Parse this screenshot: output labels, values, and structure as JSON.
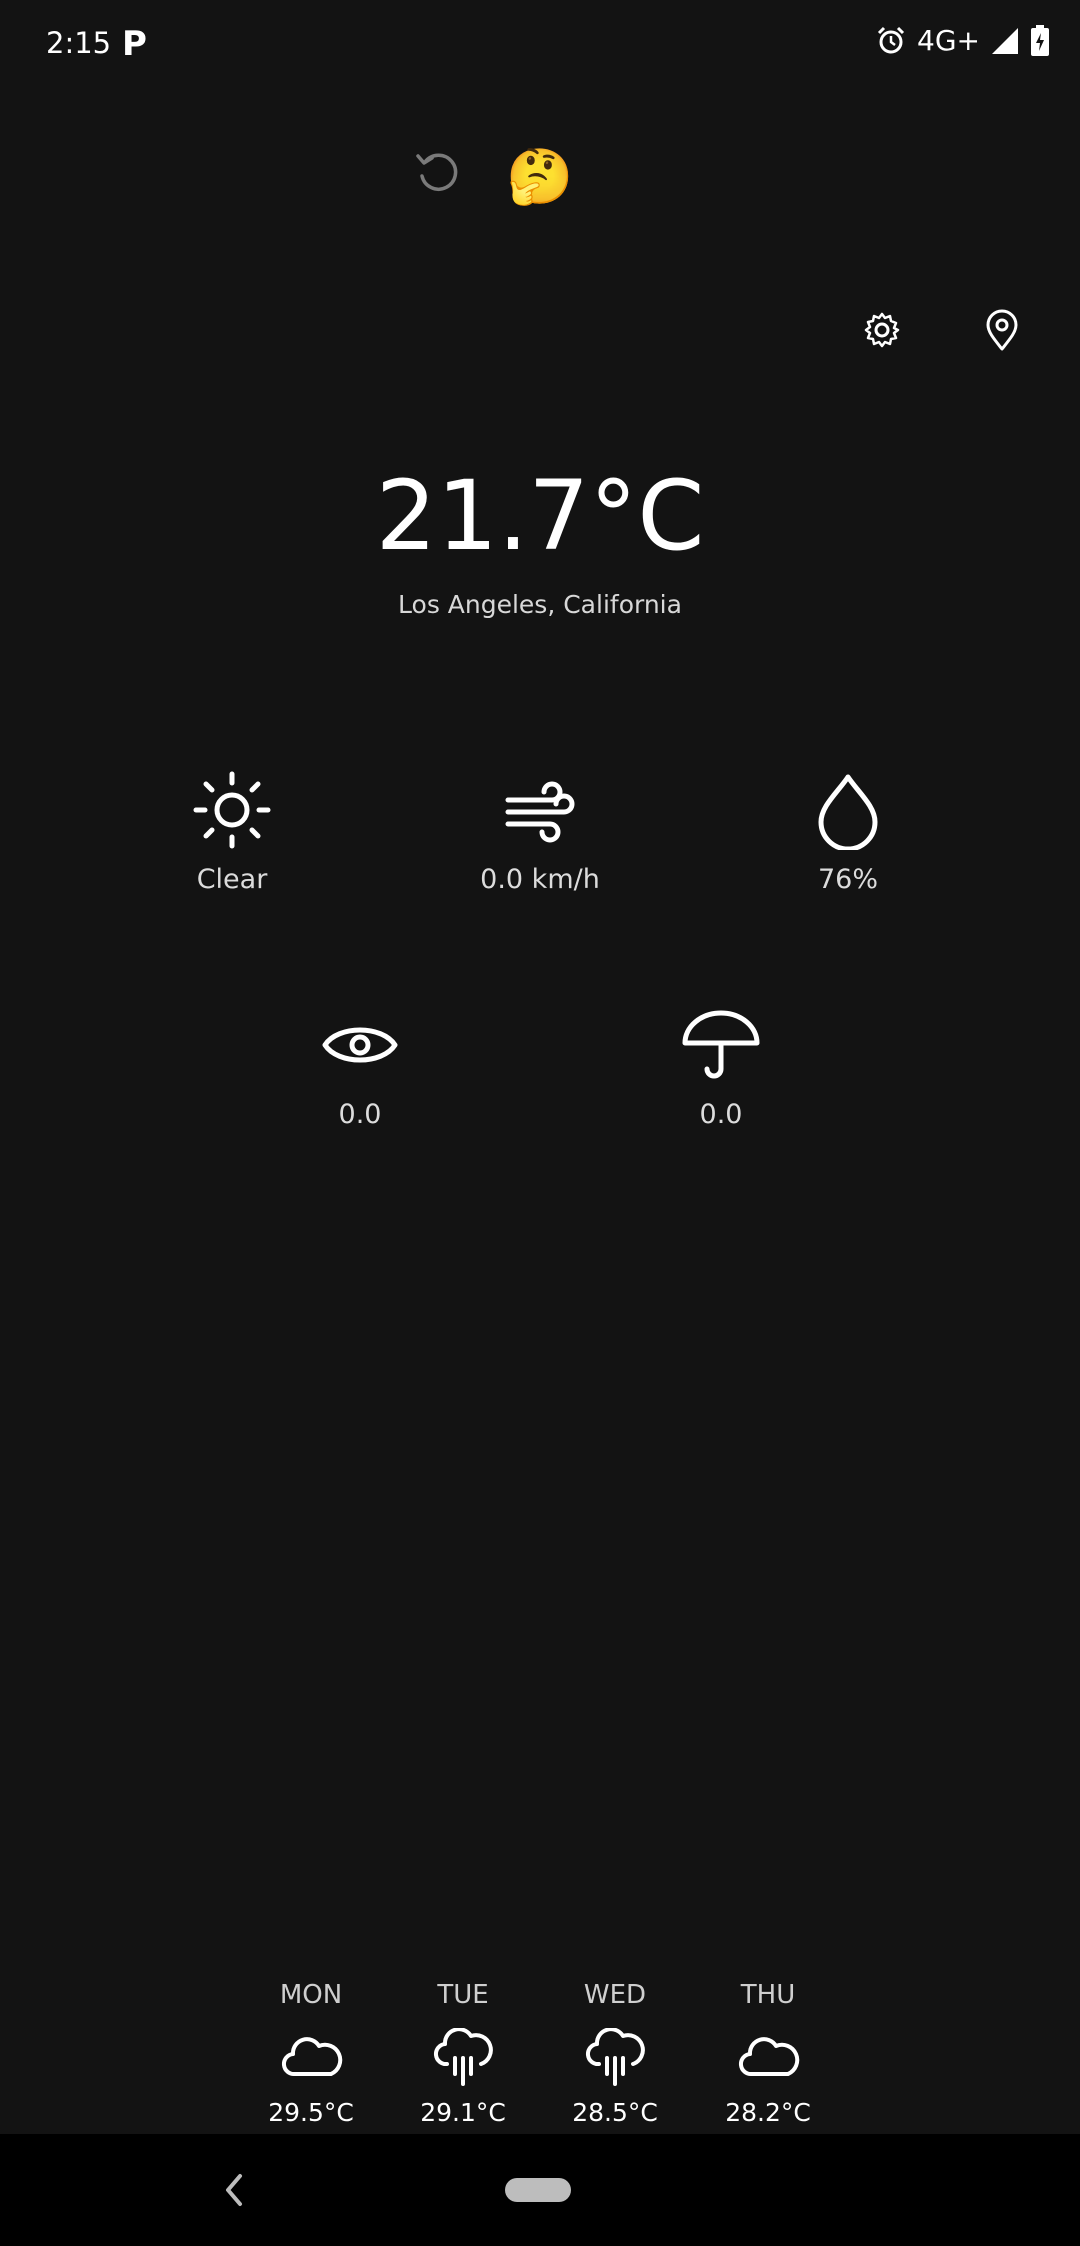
{
  "status_bar": {
    "time": "2:15",
    "app_letter": "P",
    "network": "4G+",
    "icons": [
      "alarm-icon",
      "signal-icon",
      "battery-icon"
    ]
  },
  "toolbar": {
    "emoji": "🤔",
    "icons": [
      "refresh-icon",
      "settings-gear-icon",
      "location-pin-icon"
    ]
  },
  "weather": {
    "temperature": "21.7°C",
    "location": "Los Angeles, California",
    "metrics": [
      {
        "icon": "sun-icon",
        "label": "Clear"
      },
      {
        "icon": "wind-icon",
        "label": "0.0 km/h"
      },
      {
        "icon": "humidity-drop-icon",
        "label": "76%"
      },
      {
        "icon": "visibility-eye-icon",
        "label": "0.0"
      },
      {
        "icon": "umbrella-icon",
        "label": "0.0"
      }
    ]
  },
  "forecast": [
    {
      "day": "MON",
      "icon": "cloud-icon",
      "temp": "29.5°C"
    },
    {
      "day": "TUE",
      "icon": "rain-cloud-icon",
      "temp": "29.1°C"
    },
    {
      "day": "WED",
      "icon": "rain-cloud-icon",
      "temp": "28.5°C"
    },
    {
      "day": "THU",
      "icon": "cloud-icon",
      "temp": "28.2°C"
    }
  ],
  "colors": {
    "background": "#131313",
    "text": "#ffffff",
    "muted_text": "#d8d8d8",
    "nav_bar": "#000000"
  }
}
